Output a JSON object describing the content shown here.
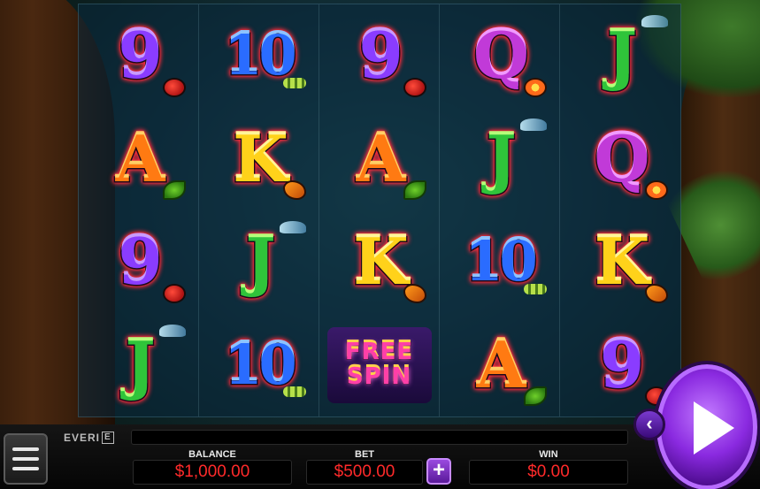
{
  "brand": {
    "name": "EVERI",
    "mark": "E"
  },
  "reels": [
    [
      {
        "glyph": "9",
        "cls": "sym-9",
        "deco": "deco-ladybug"
      },
      {
        "glyph": "A",
        "cls": "sym-A",
        "deco": "deco-leaf"
      },
      {
        "glyph": "9",
        "cls": "sym-9",
        "deco": "deco-ladybug"
      },
      {
        "glyph": "J",
        "cls": "sym-J",
        "deco": "deco-dragonfly"
      }
    ],
    [
      {
        "glyph": "10",
        "cls": "sym-10",
        "deco": "deco-caterpillar"
      },
      {
        "glyph": "K",
        "cls": "sym-K",
        "deco": "deco-butterfly"
      },
      {
        "glyph": "J",
        "cls": "sym-J",
        "deco": "deco-dragonfly"
      },
      {
        "glyph": "10",
        "cls": "sym-10",
        "deco": "deco-caterpillar"
      }
    ],
    [
      {
        "glyph": "9",
        "cls": "sym-9",
        "deco": "deco-ladybug"
      },
      {
        "glyph": "A",
        "cls": "sym-A",
        "deco": "deco-leaf"
      },
      {
        "glyph": "K",
        "cls": "sym-K",
        "deco": "deco-butterfly"
      },
      {
        "glyph": "FREE SPIN",
        "cls": "free-spin",
        "deco": ""
      }
    ],
    [
      {
        "glyph": "Q",
        "cls": "sym-Q",
        "deco": "deco-flower"
      },
      {
        "glyph": "J",
        "cls": "sym-J",
        "deco": "deco-dragonfly"
      },
      {
        "glyph": "10",
        "cls": "sym-10",
        "deco": "deco-caterpillar"
      },
      {
        "glyph": "A",
        "cls": "sym-A",
        "deco": "deco-leaf"
      }
    ],
    [
      {
        "glyph": "J",
        "cls": "sym-J",
        "deco": "deco-dragonfly"
      },
      {
        "glyph": "Q",
        "cls": "sym-Q",
        "deco": "deco-flower"
      },
      {
        "glyph": "K",
        "cls": "sym-K",
        "deco": "deco-butterfly"
      },
      {
        "glyph": "9",
        "cls": "sym-9",
        "deco": "deco-ladybug"
      }
    ]
  ],
  "free_spin": {
    "line1": "FREE",
    "line2": "SPIN"
  },
  "balance": {
    "label": "BALANCE",
    "value": "$1,000.00"
  },
  "bet": {
    "label": "BET",
    "value": "$500.00",
    "increase": "+"
  },
  "win": {
    "label": "WIN",
    "value": "$0.00"
  },
  "controls": {
    "back_glyph": "‹",
    "menu_icon": "hamburger-menu-icon",
    "spin_icon": "play-triangle-icon"
  },
  "colors": {
    "value_text": "#ff2a2a",
    "accent_purple": "#8a2ae0",
    "bar_bg": "#050505"
  }
}
